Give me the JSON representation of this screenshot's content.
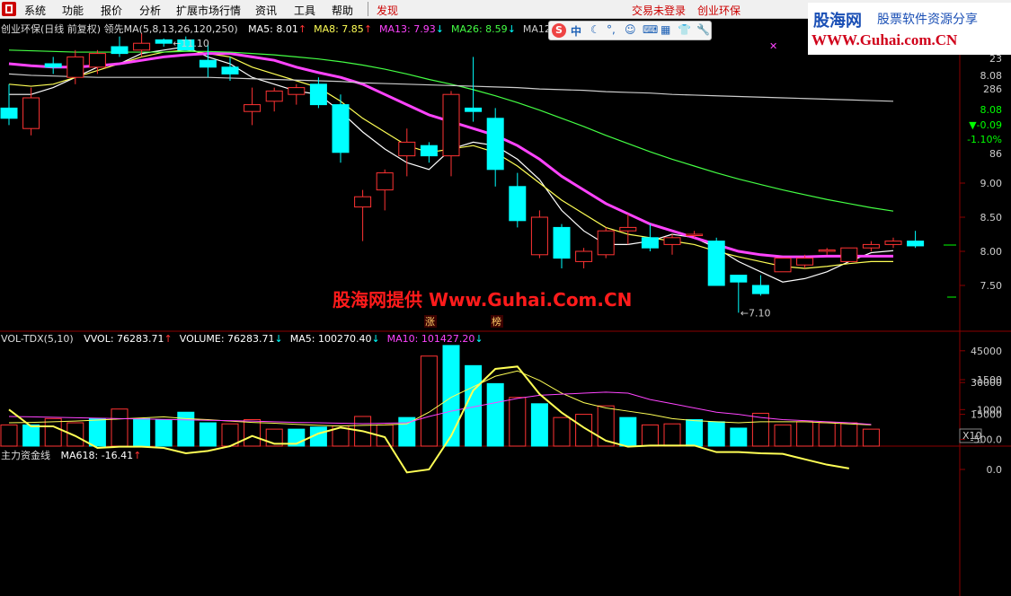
{
  "menu": {
    "items": [
      "系统",
      "功能",
      "报价",
      "分析",
      "扩展市场行情",
      "资讯",
      "工具",
      "帮助",
      "发现"
    ],
    "trade_status": "交易未登录",
    "stock_link": "创业环保"
  },
  "watermark": {
    "brand": "股海网",
    "slogan": "股票软件资源分享",
    "url": "WWW.Guhai.com.CN",
    "center_text": "股海网提供 Www.Guhai.Com.CN"
  },
  "ime": {
    "mode": "中"
  },
  "price_panel": {
    "stock_title": "创业环保(日线 前复权) 领先",
    "ma_params": "MA(5,8,13,26,120,250)",
    "indicators": [
      {
        "label": "MA5: 8.01",
        "arrow": "↑",
        "color": "#ffffff"
      },
      {
        "label": "MA8: 7.85",
        "arrow": "↑",
        "color": "#ffff55"
      },
      {
        "label": "MA13: 7.93",
        "arrow": "↓",
        "color": "#ff44ff"
      },
      {
        "label": "MA26: 8.59",
        "arrow": "↓",
        "color": "#44ff44"
      },
      {
        "label": "MA120: 1",
        "arrow": "",
        "color": "#cccccc"
      }
    ],
    "high_label": "11.10",
    "low_label": "7.10",
    "tags": [
      "涨",
      "榜"
    ],
    "right_stats": [
      {
        "text": "23",
        "color": "#cccccc"
      },
      {
        "text": "8.08",
        "color": "#cccccc"
      },
      {
        "text": "286",
        "color": "#cccccc"
      },
      {
        "text": "8.08",
        "color": "#00ff00"
      },
      {
        "text": "▼-0.09",
        "color": "#00ff00"
      },
      {
        "text": "-1.10%",
        "color": "#00ff00"
      },
      {
        "text": "86",
        "color": "#cccccc"
      }
    ]
  },
  "volume_panel": {
    "title": "VOL-TDX(5,10)",
    "indicators": [
      {
        "label": "VVOL: 76283.71",
        "arrow": "↑",
        "color": "#ffffff"
      },
      {
        "label": "VOLUME: 76283.71",
        "arrow": "↓",
        "color": "#ffffff"
      },
      {
        "label": "MA5: 100270.40",
        "arrow": "↓",
        "color": "#ffffff"
      },
      {
        "label": "MA10: 101427.20",
        "arrow": "↓",
        "color": "#ff44ff"
      }
    ],
    "unit_badge": "X10"
  },
  "fund_panel": {
    "title": "主力资金线",
    "indicators": [
      {
        "label": "MA618: -16.41",
        "arrow": "↑",
        "color": "#ffffff"
      }
    ]
  },
  "colors": {
    "up": "#ff3333",
    "down": "#00ffff",
    "grid": "#8b0000"
  },
  "chart_data": [
    {
      "type": "candlestick",
      "title": "创业环保(日线 前复权)",
      "ylim": [
        7.0,
        11.5
      ],
      "y_ticks": [
        9.0,
        8.5,
        8.0,
        7.5
      ],
      "candles": [
        {
          "o": 10.1,
          "h": 10.45,
          "l": 9.85,
          "c": 9.95
        },
        {
          "o": 9.8,
          "h": 10.4,
          "l": 9.7,
          "c": 10.25
        },
        {
          "o": 10.75,
          "h": 10.85,
          "l": 10.6,
          "c": 10.7
        },
        {
          "o": 10.55,
          "h": 10.95,
          "l": 10.45,
          "c": 10.85
        },
        {
          "o": 10.7,
          "h": 10.95,
          "l": 10.6,
          "c": 10.9
        },
        {
          "o": 11.0,
          "h": 11.15,
          "l": 10.85,
          "c": 10.9
        },
        {
          "o": 10.95,
          "h": 11.2,
          "l": 10.85,
          "c": 11.05
        },
        {
          "o": 11.1,
          "h": 11.12,
          "l": 11.0,
          "c": 11.05
        },
        {
          "o": 11.1,
          "h": 11.15,
          "l": 10.95,
          "c": 10.95
        },
        {
          "o": 10.8,
          "h": 11.05,
          "l": 10.55,
          "c": 10.7
        },
        {
          "o": 10.7,
          "h": 10.85,
          "l": 10.5,
          "c": 10.6
        },
        {
          "o": 10.05,
          "h": 10.4,
          "l": 9.85,
          "c": 10.15
        },
        {
          "o": 10.2,
          "h": 10.4,
          "l": 10.05,
          "c": 10.35
        },
        {
          "o": 10.3,
          "h": 10.45,
          "l": 10.15,
          "c": 10.4
        },
        {
          "o": 10.45,
          "h": 10.55,
          "l": 10.1,
          "c": 10.15
        },
        {
          "o": 10.15,
          "h": 10.3,
          "l": 9.3,
          "c": 9.45
        },
        {
          "o": 8.65,
          "h": 8.9,
          "l": 8.15,
          "c": 8.8
        },
        {
          "o": 8.9,
          "h": 9.2,
          "l": 8.6,
          "c": 9.15
        },
        {
          "o": 9.4,
          "h": 9.8,
          "l": 9.1,
          "c": 9.6
        },
        {
          "o": 9.55,
          "h": 9.6,
          "l": 9.3,
          "c": 9.4
        },
        {
          "o": 9.4,
          "h": 10.35,
          "l": 9.1,
          "c": 10.3
        },
        {
          "o": 10.1,
          "h": 10.85,
          "l": 9.9,
          "c": 10.05
        },
        {
          "o": 9.95,
          "h": 10.1,
          "l": 8.95,
          "c": 9.2
        },
        {
          "o": 8.95,
          "h": 9.15,
          "l": 8.35,
          "c": 8.45
        },
        {
          "o": 7.95,
          "h": 8.6,
          "l": 7.9,
          "c": 8.5
        },
        {
          "o": 8.35,
          "h": 8.4,
          "l": 7.75,
          "c": 7.9
        },
        {
          "o": 7.85,
          "h": 8.05,
          "l": 7.75,
          "c": 8.0
        },
        {
          "o": 7.95,
          "h": 8.35,
          "l": 7.9,
          "c": 8.3
        },
        {
          "o": 8.3,
          "h": 8.55,
          "l": 8.1,
          "c": 8.35
        },
        {
          "o": 8.2,
          "h": 8.4,
          "l": 8.0,
          "c": 8.05
        },
        {
          "o": 8.1,
          "h": 8.25,
          "l": 7.95,
          "c": 8.2
        },
        {
          "o": 8.25,
          "h": 8.3,
          "l": 8.2,
          "c": 8.25
        },
        {
          "o": 8.15,
          "h": 8.2,
          "l": 7.5,
          "c": 7.5
        },
        {
          "o": 7.65,
          "h": 7.65,
          "l": 7.1,
          "c": 7.55
        },
        {
          "o": 7.5,
          "h": 7.65,
          "l": 7.35,
          "c": 7.38
        },
        {
          "o": 7.7,
          "h": 7.9,
          "l": 7.7,
          "c": 7.9
        },
        {
          "o": 7.8,
          "h": 7.95,
          "l": 7.75,
          "c": 7.9
        },
        {
          "o": 8.0,
          "h": 8.05,
          "l": 7.95,
          "c": 8.02
        },
        {
          "o": 7.85,
          "h": 8.05,
          "l": 7.85,
          "c": 8.05
        },
        {
          "o": 8.05,
          "h": 8.15,
          "l": 8.0,
          "c": 8.1
        },
        {
          "o": 8.1,
          "h": 8.2,
          "l": 8.05,
          "c": 8.15
        },
        {
          "o": 8.15,
          "h": 8.3,
          "l": 8.05,
          "c": 8.08
        }
      ],
      "series": [
        {
          "name": "MA5",
          "color": "#ffffff",
          "values": [
            10.3,
            10.3,
            10.4,
            10.55,
            10.7,
            10.75,
            10.9,
            10.95,
            11.0,
            10.85,
            10.75,
            10.55,
            10.45,
            10.35,
            10.3,
            10.05,
            9.75,
            9.5,
            9.3,
            9.2,
            9.5,
            9.6,
            9.55,
            9.35,
            9.05,
            8.6,
            8.3,
            8.1,
            8.1,
            8.15,
            8.25,
            8.2,
            8.05,
            7.85,
            7.7,
            7.55,
            7.6,
            7.7,
            7.85,
            7.98,
            8.01
          ]
        },
        {
          "name": "MA8",
          "color": "#ffff55",
          "values": [
            10.45,
            10.42,
            10.45,
            10.55,
            10.65,
            10.75,
            10.85,
            10.92,
            10.95,
            10.9,
            10.85,
            10.7,
            10.6,
            10.5,
            10.4,
            10.2,
            9.95,
            9.75,
            9.55,
            9.45,
            9.5,
            9.55,
            9.45,
            9.25,
            9.0,
            8.75,
            8.55,
            8.35,
            8.25,
            8.2,
            8.15,
            8.1,
            8.0,
            7.92,
            7.85,
            7.78,
            7.75,
            7.78,
            7.82,
            7.85,
            7.85
          ]
        },
        {
          "name": "MA13",
          "color": "#ff44ff",
          "values": [
            10.75,
            10.72,
            10.7,
            10.7,
            10.72,
            10.75,
            10.8,
            10.85,
            10.88,
            10.9,
            10.9,
            10.85,
            10.8,
            10.7,
            10.62,
            10.55,
            10.45,
            10.3,
            10.15,
            10.0,
            9.9,
            9.8,
            9.7,
            9.55,
            9.35,
            9.1,
            8.9,
            8.7,
            8.55,
            8.4,
            8.3,
            8.2,
            8.1,
            8.0,
            7.95,
            7.92,
            7.92,
            7.93,
            7.93,
            7.93,
            7.93
          ]
        },
        {
          "name": "MA26",
          "color": "#44ff44",
          "values": [
            10.95,
            10.94,
            10.93,
            10.92,
            10.92,
            10.92,
            10.92,
            10.92,
            10.93,
            10.93,
            10.92,
            10.9,
            10.88,
            10.85,
            10.82,
            10.78,
            10.73,
            10.67,
            10.6,
            10.52,
            10.45,
            10.37,
            10.28,
            10.18,
            10.07,
            9.95,
            9.83,
            9.7,
            9.58,
            9.46,
            9.35,
            9.25,
            9.15,
            9.06,
            8.98,
            8.9,
            8.83,
            8.76,
            8.7,
            8.64,
            8.59
          ]
        },
        {
          "name": "MA120",
          "color": "#cccccc",
          "values": [
            10.6,
            10.58,
            10.57,
            10.56,
            10.55,
            10.55,
            10.55,
            10.55,
            10.55,
            10.55,
            10.54,
            10.53,
            10.52,
            10.51,
            10.5,
            10.49,
            10.47,
            10.46,
            10.45,
            10.44,
            10.43,
            10.42,
            10.41,
            10.4,
            10.38,
            10.37,
            10.36,
            10.34,
            10.33,
            10.32,
            10.3,
            10.29,
            10.28,
            10.27,
            10.26,
            10.25,
            10.24,
            10.23,
            10.22,
            10.21,
            10.2
          ]
        }
      ]
    },
    {
      "type": "bar",
      "title": "VOL-TDX(5,10)",
      "ylim": [
        0,
        50000
      ],
      "y_ticks": [
        45000,
        30000,
        15000
      ],
      "values": [
        10000,
        10000,
        13000,
        11000,
        13000,
        17500,
        13000,
        12500,
        16000,
        11000,
        10500,
        12500,
        8000,
        8000,
        9000,
        9500,
        14000,
        10000,
        13500,
        42500,
        47500,
        38000,
        29500,
        23000,
        20000,
        13500,
        15000,
        19000,
        13500,
        10000,
        10500,
        12500,
        11500,
        8500,
        15500,
        10000,
        11500,
        11000,
        11000,
        8000
      ],
      "series": [
        {
          "name": "MA5",
          "color": "#ffff55",
          "values": [
            11000,
            11200,
            11500,
            11800,
            12300,
            12800,
            13300,
            13800,
            13000,
            12500,
            11800,
            11200,
            10800,
            10300,
            9800,
            9500,
            9800,
            10000,
            10500,
            16000,
            23000,
            28000,
            33000,
            35500,
            31000,
            25000,
            20500,
            18000,
            16500,
            15000,
            13000,
            12000,
            11500,
            11000,
            11500,
            11500,
            11500,
            11000,
            10500,
            10000
          ]
        },
        {
          "name": "MA10",
          "color": "#ff44ff",
          "values": [
            14000,
            13800,
            13600,
            13400,
            13200,
            13000,
            12800,
            12600,
            12400,
            12200,
            12000,
            11800,
            11500,
            11200,
            11000,
            10800,
            10600,
            10800,
            11000,
            14000,
            16500,
            18500,
            20500,
            22500,
            24000,
            24500,
            25000,
            25500,
            25000,
            22000,
            20000,
            18000,
            16000,
            15000,
            13500,
            12500,
            12000,
            11500,
            11000,
            10200
          ]
        }
      ]
    },
    {
      "type": "line",
      "title": "主力资金线",
      "ylim": [
        -2000,
        200
      ],
      "y_ticks": [
        0.0,
        -500.0,
        -1000,
        -1500
      ],
      "series": [
        {
          "name": "MA618",
          "color": "#ffff55",
          "values": [
            -1000,
            -720,
            -720,
            -560,
            -360,
            -380,
            -380,
            -360,
            -270,
            -310,
            -390,
            -560,
            -430,
            -430,
            -600,
            -700,
            -640,
            -540,
            50,
            0,
            -560,
            -1320,
            -1680,
            -1720,
            -1260,
            -950,
            -700,
            -480,
            -380,
            -400,
            -400,
            -400,
            -290,
            -290,
            -270,
            -260,
            -170,
            -80,
            -16.41
          ]
        }
      ]
    }
  ]
}
